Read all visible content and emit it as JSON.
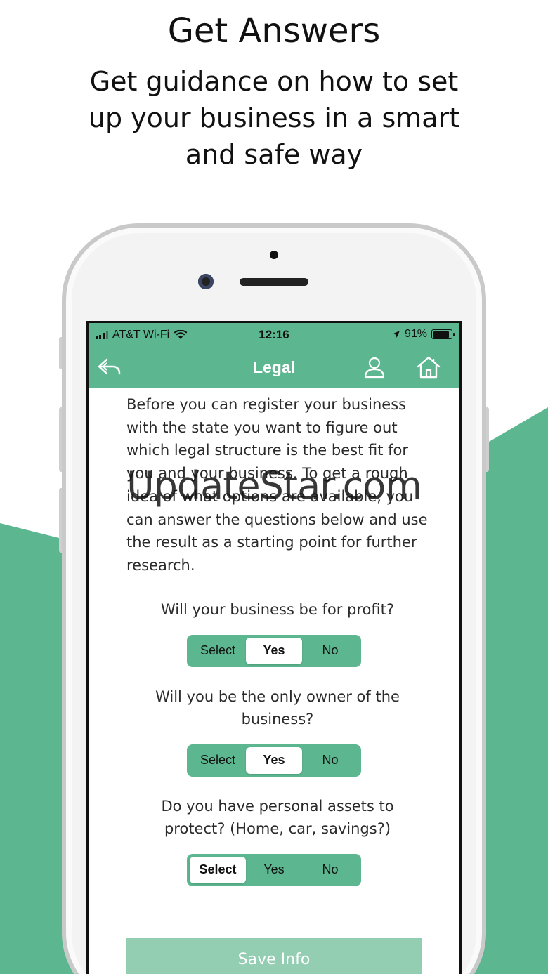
{
  "promo": {
    "headline": "Get Answers",
    "subheadline": "Get guidance on how to set up your business in a smart and safe way"
  },
  "colors": {
    "accent": "#5cb68f",
    "save_button": "#93cdb2"
  },
  "status_bar": {
    "carrier": "AT&T Wi-Fi",
    "time": "12:16",
    "battery": "91%",
    "battery_level": 0.91
  },
  "nav": {
    "title": "Legal",
    "back_icon": "back-arrow-icon",
    "profile_icon": "user-icon",
    "home_icon": "home-icon"
  },
  "intro_text": "Before you can register your business with the state you want to figure out which legal structure is the best fit for you and your business. To get a rough idea of what options are available, you can answer the questions below and use the result as a starting point for further research.",
  "questions": [
    {
      "text": "Will your business be for profit?",
      "options": [
        "Select",
        "Yes",
        "No"
      ],
      "selected": "Yes"
    },
    {
      "text": "Will you be the only owner of the business?",
      "options": [
        "Select",
        "Yes",
        "No"
      ],
      "selected": "Yes"
    },
    {
      "text": "Do you have personal assets to protect? (Home, car, savings?)",
      "options": [
        "Select",
        "Yes",
        "No"
      ],
      "selected": "Select"
    }
  ],
  "save_button": "Save Info",
  "watermark": "UpdateStar.com"
}
